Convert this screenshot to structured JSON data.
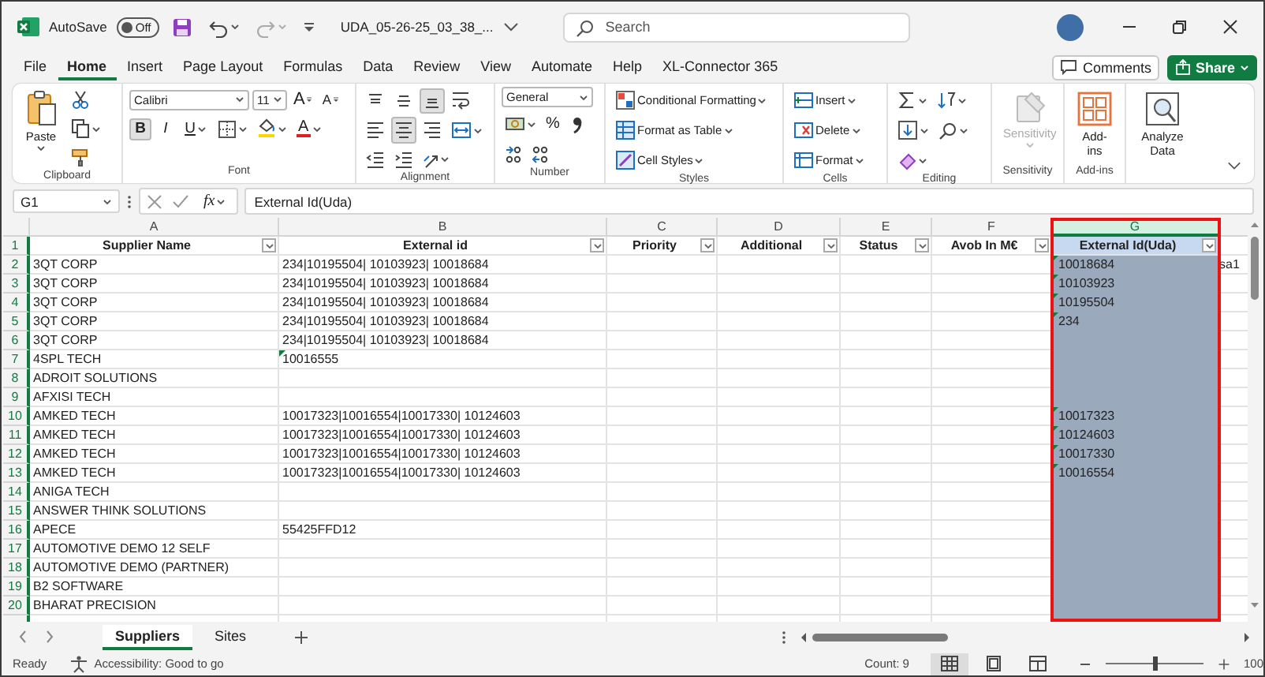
{
  "title_bar": {
    "autosave_label": "AutoSave",
    "autosave": {
      "label": "Off",
      "on": false
    },
    "file_name": "UDA_05-26-25_03_38_...",
    "search": {
      "placeholder": "Search"
    }
  },
  "menu_tabs": [
    {
      "label": "File",
      "selected": false
    },
    {
      "label": "Home",
      "selected": true
    },
    {
      "label": "Insert",
      "selected": false
    },
    {
      "label": "Page Layout",
      "selected": false
    },
    {
      "label": "Formulas",
      "selected": false
    },
    {
      "label": "Data",
      "selected": false
    },
    {
      "label": "Review",
      "selected": false
    },
    {
      "label": "View",
      "selected": false
    },
    {
      "label": "Automate",
      "selected": false
    },
    {
      "label": "Help",
      "selected": false
    },
    {
      "label": "XL-Connector 365",
      "selected": false
    }
  ],
  "comments_button": "Comments",
  "share_button": "Share",
  "ribbon": {
    "groups": [
      {
        "kind": "clipboard",
        "label": "Clipboard",
        "paste": "Paste"
      },
      {
        "kind": "font",
        "label": "Font",
        "font_name": "Calibri",
        "font_size": "11",
        "grow": "A",
        "shrink": "A",
        "font_color": "A",
        "styles": [
          {
            "label": "B",
            "selected": true
          },
          {
            "label": "I",
            "selected": false
          },
          {
            "label": "U",
            "selected": false
          }
        ]
      },
      {
        "kind": "alignment",
        "label": "Alignment",
        "vertical_align": [
          {
            "selected": false
          },
          {
            "selected": false
          },
          {
            "selected": true
          }
        ],
        "horizontal_align": [
          {
            "selected": false
          },
          {
            "selected": true
          },
          {
            "selected": false
          }
        ]
      },
      {
        "kind": "number",
        "label": "Number",
        "format": "General",
        "percent": "%"
      },
      {
        "kind": "styles",
        "label": "Styles",
        "items": [
          "Conditional Formatting",
          "Format as Table",
          "Cell Styles"
        ]
      },
      {
        "kind": "cells",
        "label": "Cells",
        "items": [
          "Insert",
          "Delete",
          "Format"
        ]
      },
      {
        "kind": "editing",
        "label": "Editing"
      },
      {
        "kind": "sensitivity",
        "label": "Sensitivity",
        "button": "Sensitivity",
        "disabled": true
      },
      {
        "kind": "addins",
        "label": "Add-ins",
        "button": "Add-ins"
      },
      {
        "kind": "analyze",
        "button": "Analyze Data"
      }
    ]
  },
  "formula_bar": {
    "name_box": "G1",
    "function_label": "fx",
    "formula": "External Id(Uda)"
  },
  "columns": [
    {
      "letter": "A",
      "title": "Supplier Name",
      "selected": false,
      "highlighted": false
    },
    {
      "letter": "B",
      "title": "External id",
      "selected": false,
      "highlighted": false
    },
    {
      "letter": "C",
      "title": "Priority",
      "selected": false,
      "highlighted": false
    },
    {
      "letter": "D",
      "title": "Additional",
      "selected": false,
      "highlighted": false
    },
    {
      "letter": "E",
      "title": "Status",
      "selected": false,
      "highlighted": false
    },
    {
      "letter": "F",
      "title": "Avob In M€",
      "selected": false,
      "highlighted": false
    },
    {
      "letter": "G",
      "title": "External Id(Uda)",
      "selected": true,
      "highlighted": true
    }
  ],
  "header_row": "1",
  "rows": [
    {
      "row": "2",
      "cells": {
        "A": "3QT CORP",
        "B": "234|10195504| 10103923| 10018684",
        "G": "10018684",
        "H": "sa1"
      },
      "flags": {
        "B": false,
        "G": true
      }
    },
    {
      "row": "3",
      "cells": {
        "A": "3QT CORP",
        "B": "234|10195504| 10103923| 10018684",
        "G": "10103923"
      },
      "flags": {
        "B": false,
        "G": true
      }
    },
    {
      "row": "4",
      "cells": {
        "A": "3QT CORP",
        "B": "234|10195504| 10103923| 10018684",
        "G": "10195504"
      },
      "flags": {
        "B": false,
        "G": true
      }
    },
    {
      "row": "5",
      "cells": {
        "A": "3QT CORP",
        "B": "234|10195504| 10103923| 10018684",
        "G": "234"
      },
      "flags": {
        "B": false,
        "G": true
      }
    },
    {
      "row": "6",
      "cells": {
        "A": "3QT CORP",
        "B": "234|10195504| 10103923| 10018684"
      },
      "flags": {
        "B": false
      }
    },
    {
      "row": "7",
      "cells": {
        "A": "4SPL TECH",
        "B": "10016555"
      },
      "flags": {
        "B": true
      }
    },
    {
      "row": "8",
      "cells": {
        "A": "ADROIT SOLUTIONS"
      }
    },
    {
      "row": "9",
      "cells": {
        "A": "AFXISI TECH"
      }
    },
    {
      "row": "10",
      "cells": {
        "A": "AMKED TECH",
        "B": "10017323|10016554|10017330| 10124603",
        "G": "10017323"
      },
      "flags": {
        "B": false,
        "G": true
      }
    },
    {
      "row": "11",
      "cells": {
        "A": "AMKED TECH",
        "B": "10017323|10016554|10017330| 10124603",
        "G": "10124603"
      },
      "flags": {
        "B": false,
        "G": true
      }
    },
    {
      "row": "12",
      "cells": {
        "A": "AMKED TECH",
        "B": "10017323|10016554|10017330| 10124603",
        "G": "10017330"
      },
      "flags": {
        "B": false,
        "G": true
      }
    },
    {
      "row": "13",
      "cells": {
        "A": "AMKED TECH",
        "B": "10017323|10016554|10017330| 10124603",
        "G": "10016554"
      },
      "flags": {
        "B": false,
        "G": true
      }
    },
    {
      "row": "14",
      "cells": {
        "A": "ANIGA TECH"
      }
    },
    {
      "row": "15",
      "cells": {
        "A": "ANSWER THINK SOLUTIONS"
      }
    },
    {
      "row": "16",
      "cells": {
        "A": "APECE",
        "B": "55425FFD12"
      },
      "flags": {
        "B": false
      }
    },
    {
      "row": "17",
      "cells": {
        "A": "AUTOMOTIVE DEMO 12 SELF"
      }
    },
    {
      "row": "18",
      "cells": {
        "A": "AUTOMOTIVE DEMO (PARTNER)"
      }
    },
    {
      "row": "19",
      "cells": {
        "A": "B2 SOFTWARE"
      }
    },
    {
      "row": "20",
      "cells": {
        "A": "BHARAT PRECISION"
      }
    }
  ],
  "sheet_tabs": [
    {
      "label": "Suppliers",
      "selected": true
    },
    {
      "label": "Sites",
      "selected": false
    }
  ],
  "status_bar": {
    "ready": "Ready",
    "accessibility": "Accessibility: Good to go",
    "count": "Count: 9",
    "views": [
      {
        "kind": "normal",
        "selected": true
      },
      {
        "kind": "page_layout",
        "selected": false
      },
      {
        "kind": "page_break",
        "selected": false
      }
    ],
    "zoom": {
      "level": 0.5,
      "label": "100"
    }
  }
}
